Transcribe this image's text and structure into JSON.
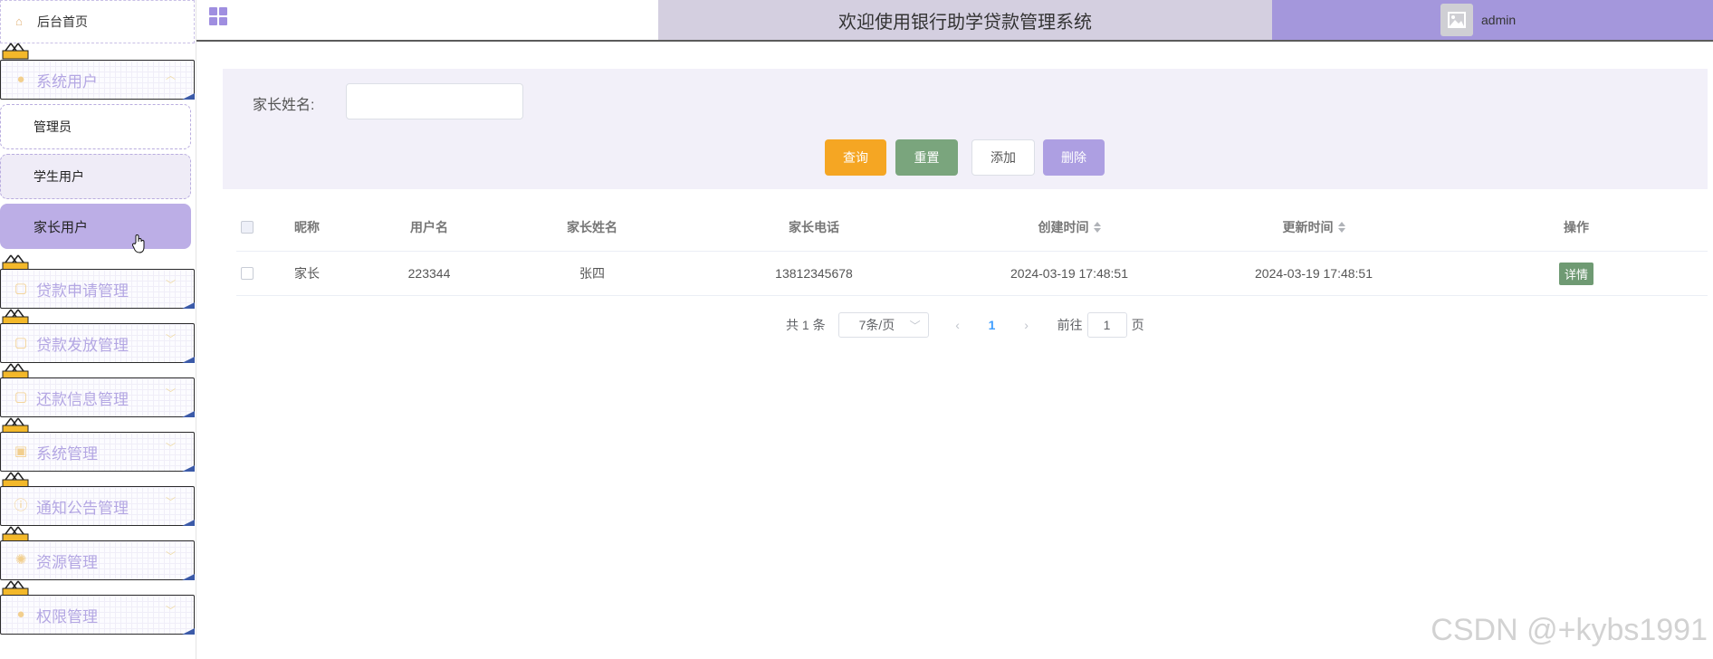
{
  "sidebar": {
    "home_label": "后台首页",
    "menus": {
      "system_users": "系统用户",
      "loan_apply": "贷款申请管理",
      "loan_release": "贷款发放管理",
      "repayment": "还款信息管理",
      "system_manage": "系统管理",
      "notice": "通知公告管理",
      "resources": "资源管理",
      "permissions": "权限管理"
    },
    "submenu": {
      "admin": "管理员",
      "student": "学生用户",
      "parent": "家长用户"
    }
  },
  "header": {
    "title": "欢迎使用银行助学贷款管理系统",
    "username": "admin"
  },
  "search": {
    "label": "家长姓名:",
    "value": "",
    "query_label": "查询",
    "reset_label": "重置",
    "add_label": "添加",
    "delete_label": "删除"
  },
  "table": {
    "headers": {
      "nickname": "昵称",
      "username": "用户名",
      "parent_name": "家长姓名",
      "parent_phone": "家长电话",
      "created": "创建时间",
      "updated": "更新时间",
      "actions": "操作"
    },
    "rows": [
      {
        "nickname": "家长",
        "username": "223344",
        "parent_name": "张四",
        "parent_phone": "13812345678",
        "created": "2024-03-19 17:48:51",
        "updated": "2024-03-19 17:48:51",
        "action": "详情"
      }
    ]
  },
  "pagination": {
    "total": "共 1 条",
    "page_size": "7条/页",
    "current": "1",
    "goto_label": "前往",
    "goto_value": "1",
    "page_suffix": "页"
  },
  "watermark": "CSDN @+kybs1991",
  "colors": {
    "accent": "#a497dc",
    "title_bar": "#d4cfe0",
    "query": "#f5a623",
    "reset": "#7aa57d",
    "delete": "#ad9fe2",
    "detail": "#6f9a73"
  }
}
